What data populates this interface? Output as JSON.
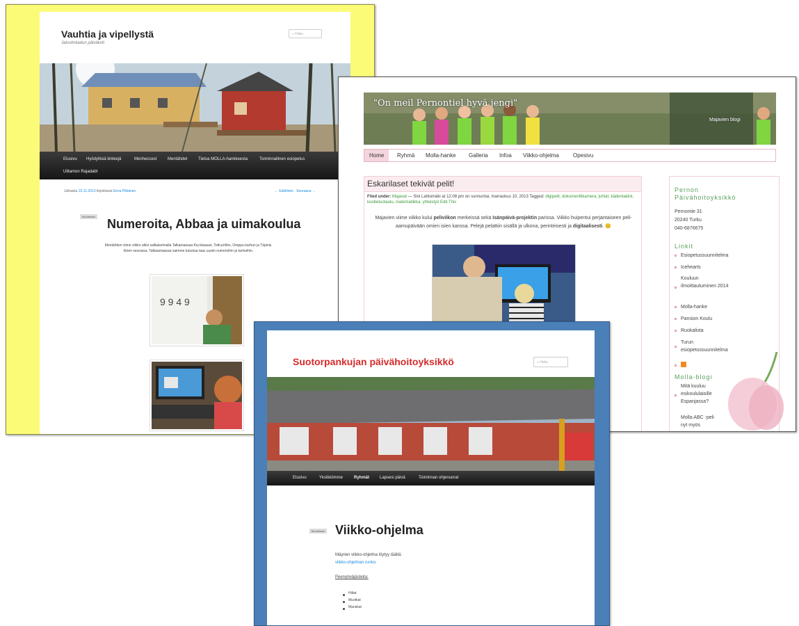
{
  "s1": {
    "title": "Vauhtia ja vipellystä",
    "tagline": "Jalustinkadun päiväkoti",
    "search_placeholder": "Haku",
    "nav": [
      "Etusivu",
      "Hyödyllisiä linkkejä",
      "Menheccest",
      "Mentähdet",
      "Tietoa MOLLA-hankkeesta",
      "Toiminnallinen esiopetus",
      "Ulitamon Rajadabt"
    ],
    "meta_prefix": "Julkaistu",
    "meta_date": "23.11.2013",
    "meta_mid": "kirjoittanut",
    "meta_author": "Eeva Pitkänen",
    "prev": "← Edellinen",
    "next": "Seuraava →",
    "badge": "Muutetaan",
    "post_title": "Numeroita, Abbaa ja uimakoulua",
    "post_body": "Mentähtien viime viikko alkoi salliaiselmalla Talkamaasaa Kiu-klaasari, Totti-pöllön, Omppu-karhun ja Täpinä-hiiren seurassa. Talkaamaasaa saimme tutustua taas uusiin numeroihin ja tarinoihin."
  },
  "s2": {
    "banner_title": "\"On meil Pernontiel hyvä jengi\"",
    "banner_right": "Majavien blogi",
    "menu": [
      "Home",
      "Ryhmä",
      "Molla-hanke",
      "Galleria",
      "Infoa",
      "Viikko-ohjelma",
      "Opesivu"
    ],
    "post_title": "Eskarilaset tekivät pelit!",
    "filed_prefix": "Filed under:",
    "filed_cat": "Majavat",
    "filed_mid": "— Sini Lahtomäki at 12:08 pm on sunnuntai, marraskuu 10, 2013 Tagged:",
    "filed_tags": "digipelit, dokumenttikamera, juhlat, kädentaidot, koobetuotaulu, matematiikka, yhteistyö Edit This",
    "text_a": "Majavien viime viikko kului ",
    "text_b": "peliviikon",
    "text_c": " merkeissä sekä ",
    "text_d": "Isänpäivä-projektin",
    "text_e": " parissa. Viikko huipentui perjantaiseen peli-aamupäivään omien isien kanssa. Pelejä pelattiin sisällä ja ulkona, perinteisesti ja ",
    "text_f": "digitaalisesti",
    "text_g": ". 😊",
    "side_heading": "Pernon Päivähoitoyksikkö",
    "address1": "Pernontie 31",
    "address2": "20240 Turku",
    "phone": "040-6876675",
    "links_heading": "Linkit",
    "links": [
      "Esiopetussuunnitelma",
      "Icehearts",
      "Kouluun ilmoittautuminen 2014",
      "Molla-hanke",
      "Pansion Koulu",
      "Ruokalista",
      "Turun esiopetussuunnitelma"
    ],
    "blog_heading": "Molla-blogi",
    "blog_posts": [
      "Mitä kuuluu esikoululaisille Espanjassa?",
      "Molla ABC -peli nyt myös"
    ]
  },
  "s3": {
    "title": "Suotorpankujan päivähoitoyksikkö",
    "search_placeholder": "Haku",
    "nav": [
      "Etusivu",
      "Yksikkömme",
      "Ryhmät",
      "Lapsesi päivä",
      "Toiminnan ohjenuorat"
    ],
    "badge": "Muutetaan",
    "post_title": "Viikko-ohjelma",
    "line1": "Mäyrien viikko-ohjelma löytyy täältä:",
    "line2": "viikko-ohjelman runko.",
    "line3": "Peenyrieäjästeita:",
    "items": [
      "Hiltat",
      "Muotkat",
      "Manskat"
    ]
  }
}
